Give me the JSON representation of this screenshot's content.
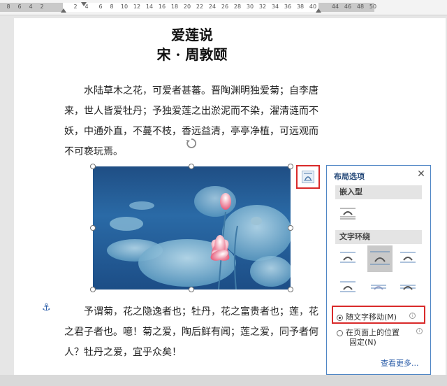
{
  "ruler": {
    "numbers": [
      "8",
      "6",
      "4",
      "2",
      "2",
      "4",
      "6",
      "8",
      "10",
      "12",
      "14",
      "16",
      "18",
      "20",
      "22",
      "24",
      "26",
      "28",
      "30",
      "32",
      "34",
      "36",
      "38",
      "40",
      "44",
      "46",
      "48",
      "50"
    ]
  },
  "document": {
    "title": "爱莲说",
    "subtitle": "宋 · 周敦颐",
    "para1": "水陆草木之花，可爱者甚蕃。晋陶渊明独爱菊；自李唐来，世人皆爱牡丹；予独爱莲之出淤泥而不染，濯清涟而不妖，中通外直，不蔓不枝，香远益清，亭亭净植，可远观而不可亵玩焉。",
    "para2": "予谓菊，花之隐逸者也；牡丹，花之富贵者也；莲，花之君子者也。噫！菊之爱，陶后鲜有闻；莲之爱，同予者何人？牡丹之爱，宜乎众矣！"
  },
  "layout_panel": {
    "title": "布局选项",
    "close": "✕",
    "inline_header": "嵌入型",
    "wrap_header": "文字环绕",
    "option_move": "随文字移动(M)",
    "option_fixed_line1": "在页面上的位置",
    "option_fixed_line2": "固定(N)",
    "see_more": "查看更多..."
  },
  "icons": {
    "anchor": "anchor-icon",
    "rotate": "rotate-icon",
    "layout": "layout-options-icon"
  },
  "colors": {
    "accent": "#2a5ca8",
    "highlight": "#d92a2a"
  }
}
